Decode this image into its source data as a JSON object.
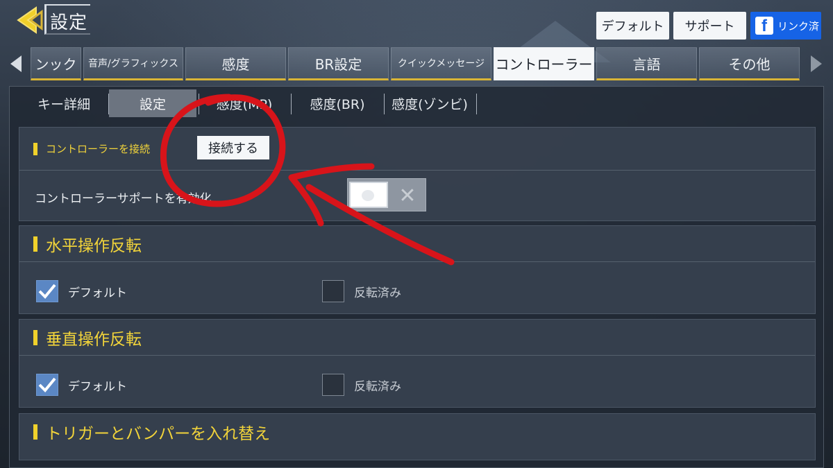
{
  "header": {
    "title": "設定",
    "buttons": {
      "default": "デフォルト",
      "support": "サポート",
      "link": "リンク済"
    }
  },
  "tabs": [
    {
      "label": "ンック"
    },
    {
      "label": "音声/グラフィックス"
    },
    {
      "label": "感度"
    },
    {
      "label": "BR設定"
    },
    {
      "label": "クイックメッセージ"
    },
    {
      "label": "コントローラー",
      "active": true
    },
    {
      "label": "言語"
    },
    {
      "label": "その他"
    }
  ],
  "subtabs": [
    {
      "label": "キー詳細"
    },
    {
      "label": "設定",
      "active": true
    },
    {
      "label": "感度(MP)"
    },
    {
      "label": "感度(BR)"
    },
    {
      "label": "感度(ゾンビ)"
    }
  ],
  "controller": {
    "heading": "コントローラーを接続",
    "connect_button": "接続する",
    "support_label": "コントローラーサポートを有効化",
    "support_enabled": false
  },
  "horizontal": {
    "heading": "水平操作反転",
    "options": [
      {
        "label": "デフォルト",
        "checked": true
      },
      {
        "label": "反転済み",
        "checked": false
      }
    ]
  },
  "vertical": {
    "heading": "垂直操作反転",
    "options": [
      {
        "label": "デフォルト",
        "checked": true
      },
      {
        "label": "反転済み",
        "checked": false
      }
    ]
  },
  "swap": {
    "heading": "トリガーとバンパーを入れ替え"
  },
  "colors": {
    "accent_yellow": "#f0d12b",
    "annotation_red": "#d8141a",
    "facebook_blue": "#1663e6"
  }
}
